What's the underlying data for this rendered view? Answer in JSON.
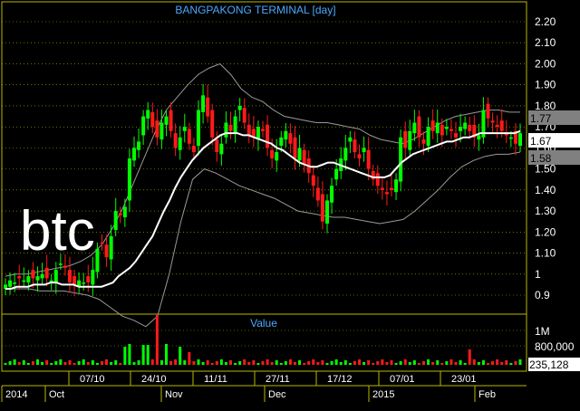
{
  "title": "BANGPAKONG TERMINAL [day]",
  "watermark": "btc",
  "volume_panel_label": "Value",
  "colors": {
    "background": "#000000",
    "up_candle": "#00ff00",
    "down_candle": "#ff1a1a",
    "moving_average": "#ffffff",
    "bollinger": "#9a9a9a",
    "grid": "#b8b800",
    "axis_text": "#ffffff",
    "title_text": "#4aa8ff",
    "top_band_box": "#808080",
    "last_price_box": "#ffffff",
    "low_band_box": "#808080"
  },
  "chart_data": [
    {
      "type": "candlestick",
      "title": "BANGPAKONG TERMINAL [day]",
      "ylim": [
        0.82,
        2.26
      ],
      "y_ticks": [
        "2.20",
        "2.10",
        "2.00",
        "1.90",
        "1.80",
        "1.70",
        "1.60",
        "1.50",
        "1.40",
        "1.30",
        "1.20",
        "1.10",
        "1",
        "0.9"
      ],
      "price_markers": {
        "bollinger_upper": "1.77",
        "last_price": "1.67",
        "bollinger_lower": "1.58"
      },
      "series": [
        {
          "name": "close",
          "values": [
            0.95,
            0.97,
            0.96,
            0.98,
            0.97,
            0.99,
            0.98,
            0.99,
            1.0,
            0.98,
            0.97,
            1.02,
            1.05,
            1.03,
            0.96,
            0.95,
            0.97,
            0.96,
            0.96,
            1.02,
            1.12,
            1.15,
            1.08,
            1.18,
            1.3,
            1.28,
            1.32,
            1.55,
            1.6,
            1.63,
            1.75,
            1.78,
            1.7,
            1.65,
            1.72,
            1.75,
            1.68,
            1.6,
            1.65,
            1.7,
            1.62,
            1.58,
            1.78,
            1.85,
            1.75,
            1.65,
            1.58,
            1.62,
            1.72,
            1.68,
            1.75,
            1.8,
            1.72,
            1.66,
            1.65,
            1.7,
            1.68,
            1.6,
            1.55,
            1.58,
            1.65,
            1.68,
            1.62,
            1.55,
            1.6,
            1.52,
            1.48,
            1.42,
            1.35,
            1.25,
            1.35,
            1.42,
            1.5,
            1.55,
            1.6,
            1.65,
            1.58,
            1.55,
            1.6,
            1.5,
            1.45,
            1.42,
            1.4,
            1.38,
            1.4,
            1.45,
            1.65,
            1.6,
            1.68,
            1.72,
            1.65,
            1.62,
            1.7,
            1.68,
            1.72,
            1.66,
            1.7,
            1.68,
            1.65,
            1.7,
            1.72,
            1.68,
            1.65,
            1.66,
            1.78,
            1.74,
            1.72,
            1.7,
            1.68,
            1.66,
            1.65,
            1.62,
            1.67
          ]
        },
        {
          "name": "moving_average",
          "values": [
            0.93,
            0.93,
            0.94,
            0.94,
            0.94,
            0.95,
            0.95,
            0.95,
            0.96,
            0.96,
            0.95,
            0.95,
            0.95,
            0.94,
            0.94,
            0.94,
            0.94,
            0.94,
            0.95,
            0.96,
            0.99,
            1.01,
            1.03,
            1.06,
            1.1,
            1.14,
            1.18,
            1.24,
            1.3,
            1.35,
            1.41,
            1.46,
            1.5,
            1.54,
            1.57,
            1.6,
            1.62,
            1.64,
            1.66,
            1.67,
            1.67,
            1.67,
            1.66,
            1.66,
            1.65,
            1.64,
            1.63,
            1.62,
            1.6,
            1.59,
            1.57,
            1.55,
            1.53,
            1.52,
            1.51,
            1.51,
            1.52,
            1.53,
            1.53,
            1.52,
            1.51,
            1.5,
            1.49,
            1.48,
            1.47,
            1.46,
            1.46,
            1.46,
            1.47,
            1.5,
            1.53,
            1.55,
            1.57,
            1.58,
            1.59,
            1.6,
            1.61,
            1.62,
            1.63,
            1.63,
            1.64,
            1.65,
            1.65,
            1.66,
            1.67,
            1.67,
            1.67,
            1.67,
            1.67,
            1.67,
            1.67,
            1.68
          ]
        },
        {
          "name": "bollinger_upper",
          "values": [
            0.99,
            1.0,
            1.0,
            1.01,
            1.02,
            1.03,
            1.04,
            1.06,
            1.09,
            1.14,
            1.22,
            1.32,
            1.44,
            1.56,
            1.68,
            1.78,
            1.84,
            1.9,
            1.95,
            1.98,
            2.0,
            1.95,
            1.88,
            1.84,
            1.82,
            1.78,
            1.75,
            1.74,
            1.73,
            1.72,
            1.72,
            1.71,
            1.7,
            1.69,
            1.66,
            1.64,
            1.63,
            1.62,
            1.64,
            1.67,
            1.7,
            1.73,
            1.75,
            1.76,
            1.77,
            1.78,
            1.78,
            1.77,
            1.77
          ]
        },
        {
          "name": "bollinger_lower",
          "values": [
            0.93,
            0.93,
            0.93,
            0.92,
            0.92,
            0.92,
            0.91,
            0.9,
            0.88,
            0.84,
            0.8,
            0.78,
            0.75,
            0.8,
            1.0,
            1.25,
            1.45,
            1.5,
            1.48,
            1.45,
            1.42,
            1.4,
            1.38,
            1.36,
            1.33,
            1.3,
            1.29,
            1.28,
            1.27,
            1.27,
            1.26,
            1.25,
            1.24,
            1.25,
            1.26,
            1.3,
            1.35,
            1.4,
            1.46,
            1.51,
            1.54,
            1.56,
            1.57,
            1.57,
            1.58
          ]
        }
      ]
    },
    {
      "type": "bar",
      "title": "Value",
      "y_ticks": [
        "1M",
        "800,000"
      ],
      "last_value_marker": "235,128"
    }
  ],
  "x_axis": {
    "date_labels": [
      "07/10",
      "24/10",
      "11/11",
      "27/11",
      "17/12",
      "07/01",
      "23/01"
    ],
    "period_labels": [
      "2014",
      "Oct",
      "Nov",
      "Dec",
      "2015",
      "Feb"
    ]
  }
}
